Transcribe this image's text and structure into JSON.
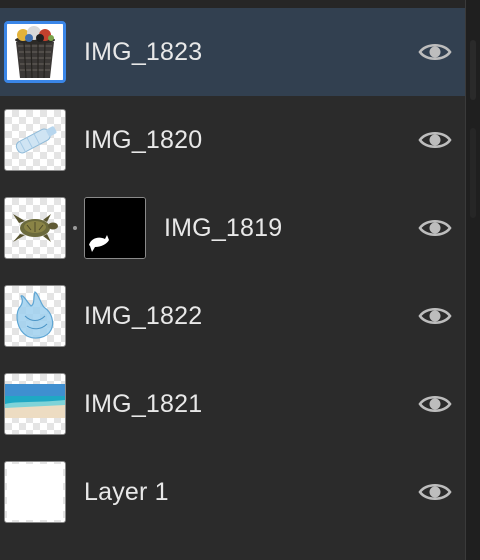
{
  "layers_panel": {
    "layers": [
      {
        "name": "IMG_1823",
        "selected": true,
        "visible": true,
        "thumbnail": "trash-bin-image",
        "has_mask": false
      },
      {
        "name": "IMG_1820",
        "selected": false,
        "visible": true,
        "thumbnail": "plastic-bottle-image",
        "has_mask": false
      },
      {
        "name": "IMG_1819",
        "selected": false,
        "visible": true,
        "thumbnail": "sea-turtle-image",
        "has_mask": true
      },
      {
        "name": "IMG_1822",
        "selected": false,
        "visible": true,
        "thumbnail": "plastic-bag-image",
        "has_mask": false
      },
      {
        "name": "IMG_1821",
        "selected": false,
        "visible": true,
        "thumbnail": "beach-image",
        "has_mask": false
      },
      {
        "name": "Layer 1",
        "selected": false,
        "visible": true,
        "thumbnail": "blank-white-layer",
        "has_mask": false
      }
    ]
  },
  "colors": {
    "panel_background": "#2b2b2b",
    "selected_row": "#324050",
    "selection_border": "#3a86e8",
    "text": "#e8e8e8",
    "eye_icon": "#bdbdbd"
  },
  "icons": {
    "visibility": "eye-icon",
    "mask_link": "link-dot-icon"
  }
}
